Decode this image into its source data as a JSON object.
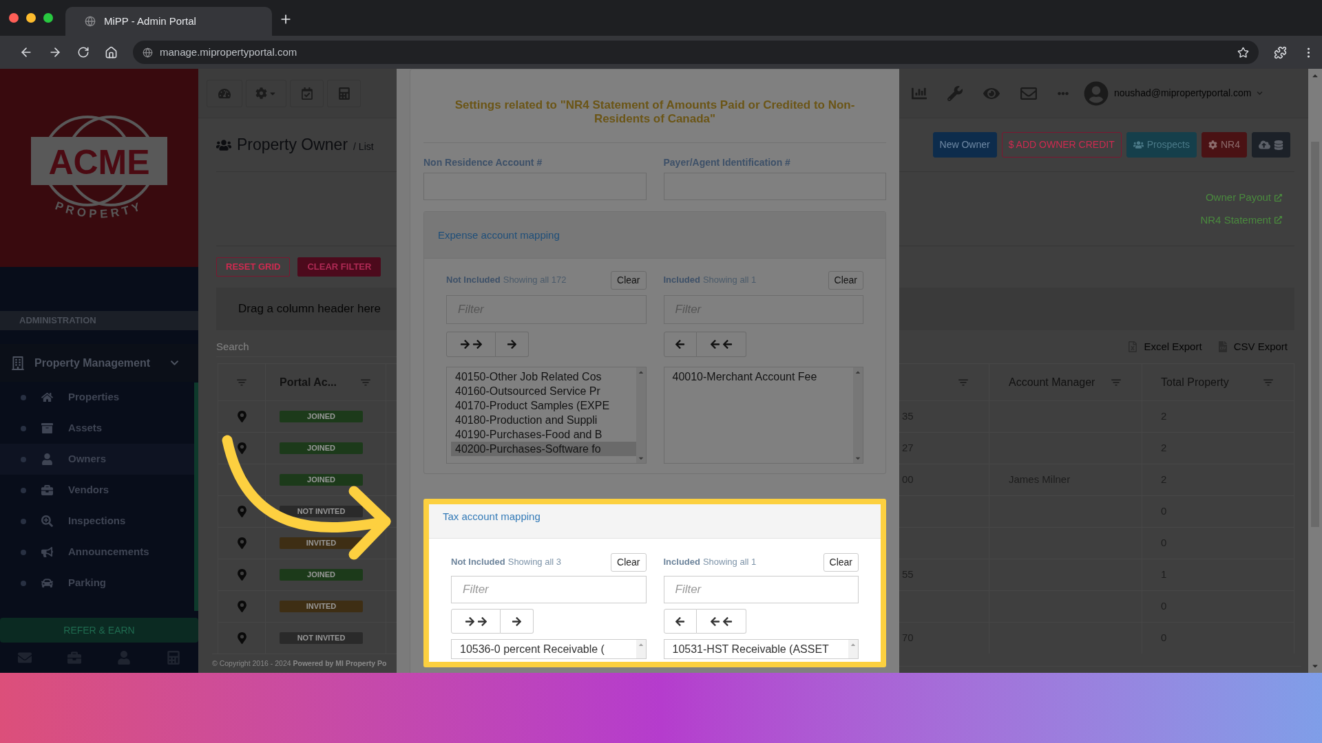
{
  "browser": {
    "tab_title": "MiPP - Admin Portal",
    "url": "manage.mipropertyportal.com"
  },
  "sidebar": {
    "brand": "ACME",
    "brand_sub": "PROPERTY",
    "section": "ADMINISTRATION",
    "group": {
      "label": "Property Management",
      "expanded": true,
      "items": [
        {
          "label": "Properties",
          "selected": false
        },
        {
          "label": "Assets",
          "selected": false
        },
        {
          "label": "Owners",
          "selected": true
        },
        {
          "label": "Vendors",
          "selected": false
        },
        {
          "label": "Inspections",
          "selected": false
        },
        {
          "label": "Announcements",
          "selected": false
        },
        {
          "label": "Parking",
          "selected": false
        }
      ]
    },
    "refer": "REFER & EARN"
  },
  "page": {
    "title": "Property Owner",
    "subtitle": "/ List",
    "grid_buttons": [
      {
        "label": "RESET GRID",
        "kind": "outline"
      },
      {
        "label": "CLEAR FILTER",
        "kind": "solid"
      }
    ],
    "group_hint": "Drag a column header here",
    "search_placeholder": "Search"
  },
  "header": {
    "user": "noushad@mipropertyportal.com"
  },
  "actions": [
    {
      "label": "New Owner",
      "kind": "primary"
    },
    {
      "label": "$ ADD OWNER CREDIT",
      "kind": "outline"
    },
    {
      "label": "Prospects",
      "kind": "info"
    },
    {
      "label": "NR4",
      "kind": "danger"
    },
    {
      "kind": "dark"
    }
  ],
  "links": [
    "Owner Payout",
    "NR4 Statement"
  ],
  "exports": [
    "Excel Export",
    "CSV Export"
  ],
  "table": {
    "column_2": "Portal Ac...",
    "column_4": "Account Manager",
    "column_5": "Total Property",
    "rows": [
      {
        "status": "JOINED",
        "color": "#1c3a1a",
        "column_3": "35",
        "total_property": "2"
      },
      {
        "status": "JOINED",
        "color": "#1c3a1a",
        "column_3": "27",
        "total_property": "2"
      },
      {
        "status": "JOINED",
        "color": "#1c3a1a",
        "column_3": "00",
        "account_manager": "James Milner",
        "total_property": "2"
      },
      {
        "status": "NOT INVITED",
        "color": "#2a2a2a",
        "total_property": "0"
      },
      {
        "status": "INVITED",
        "color": "#3e2e14",
        "total_property": "0"
      },
      {
        "status": "JOINED",
        "color": "#1c3a1a",
        "column_3": "55",
        "total_property": "1"
      },
      {
        "status": "INVITED",
        "color": "#3e2e14",
        "total_property": "0"
      },
      {
        "status": "NOT INVITED",
        "color": "#2a2a2a",
        "column_3": "70",
        "total_property": "0"
      }
    ]
  },
  "footer": "© Copyright 2016 - 2024 **Powered by MI Property Po**",
  "modal": {
    "title": "Settings related to \"NR4 Statement of Amounts Paid or Credited to Non-Residents of Canada\"",
    "fields": [
      {
        "label": "Non Residence Account #"
      },
      {
        "label": "Payer/Agent Identification #"
      }
    ],
    "mappings": [
      {
        "title": "Expense account mapping",
        "highlighted": false,
        "sides": [
          {
            "label": "Not Included",
            "count": "Showing all 172",
            "clear": "Clear",
            "placeholder": "Filter",
            "kind": "right",
            "items": [
              {
                "label": "40150-Other Job Related Cos",
                "selected": false
              },
              {
                "label": "40160-Outsourced Service Pr",
                "selected": false
              },
              {
                "label": "40170-Product Samples (EXPE",
                "selected": false
              },
              {
                "label": "40180-Production and Suppli",
                "selected": false
              },
              {
                "label": "40190-Purchases-Food and B",
                "selected": false
              },
              {
                "label": "40200-Purchases-Software fo",
                "selected": true
              }
            ]
          },
          {
            "label": "Included",
            "count": "Showing all 1",
            "clear": "Clear",
            "placeholder": "Filter",
            "kind": "left",
            "items": [
              {
                "label": "40010-Merchant Account Fee",
                "selected": false
              }
            ]
          }
        ]
      },
      {
        "title": "Tax account mapping",
        "highlighted": true,
        "sides": [
          {
            "label": "Not Included",
            "count": "Showing all 3",
            "clear": "Clear",
            "placeholder": "Filter",
            "kind": "right",
            "items": [
              {
                "label": "10536-0 percent Receivable (",
                "selected": false
              }
            ]
          },
          {
            "label": "Included",
            "count": "Showing all 1",
            "clear": "Clear",
            "placeholder": "Filter",
            "kind": "left",
            "items": [
              {
                "label": "10531-HST Receivable (ASSET",
                "selected": false
              }
            ]
          }
        ]
      }
    ]
  }
}
